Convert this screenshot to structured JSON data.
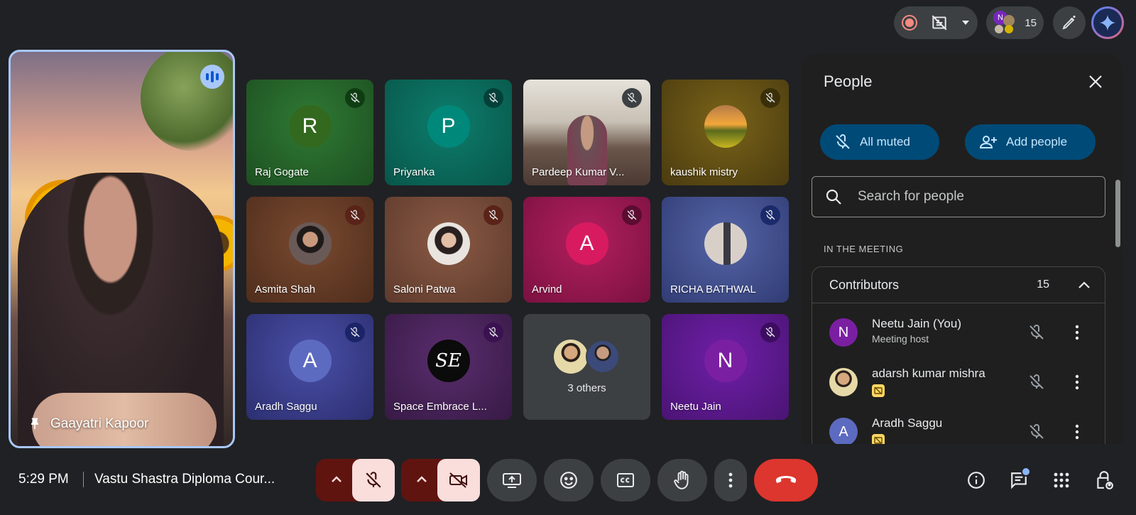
{
  "top_bar": {
    "participant_count": "15",
    "mini_avatar_letter": "N"
  },
  "pinned": {
    "name": "Gaayatri Kapoor"
  },
  "tiles": [
    {
      "name": "Raj Gogate",
      "initial": "R"
    },
    {
      "name": "Priyanka",
      "initial": "P"
    },
    {
      "name": "Pardeep Kumar V..."
    },
    {
      "name": "kaushik mistry"
    },
    {
      "name": "Asmita Shah"
    },
    {
      "name": "Saloni Patwa"
    },
    {
      "name": "Arvind",
      "initial": "A"
    },
    {
      "name": "RICHA BATHWAL"
    },
    {
      "name": "Aradh Saggu",
      "initial": "A"
    },
    {
      "name": "Space Embrace L...",
      "logo_text": "SE"
    },
    {
      "name": "3 others"
    },
    {
      "name": "Neetu Jain",
      "initial": "N"
    }
  ],
  "colors": {
    "background": "#202124",
    "accent_blue": "#a8c7fa",
    "hangup_red": "#dc362e",
    "muted_dark_red": "#601410"
  },
  "panel": {
    "title": "People",
    "all_muted_label": "All muted",
    "add_people_label": "Add people",
    "search_placeholder": "Search for people",
    "section_label": "IN THE MEETING",
    "contributors_label": "Contributors",
    "contributors_count": "15",
    "people": [
      {
        "name": "Neetu Jain (You)",
        "subtitle": "Meeting host",
        "initial": "N"
      },
      {
        "name": "adarsh kumar mishra"
      },
      {
        "name": "Aradh Saggu",
        "initial": "A"
      }
    ]
  },
  "bottom_bar": {
    "time": "5:29 PM",
    "meeting_title": "Vastu Shastra Diploma Cour..."
  }
}
